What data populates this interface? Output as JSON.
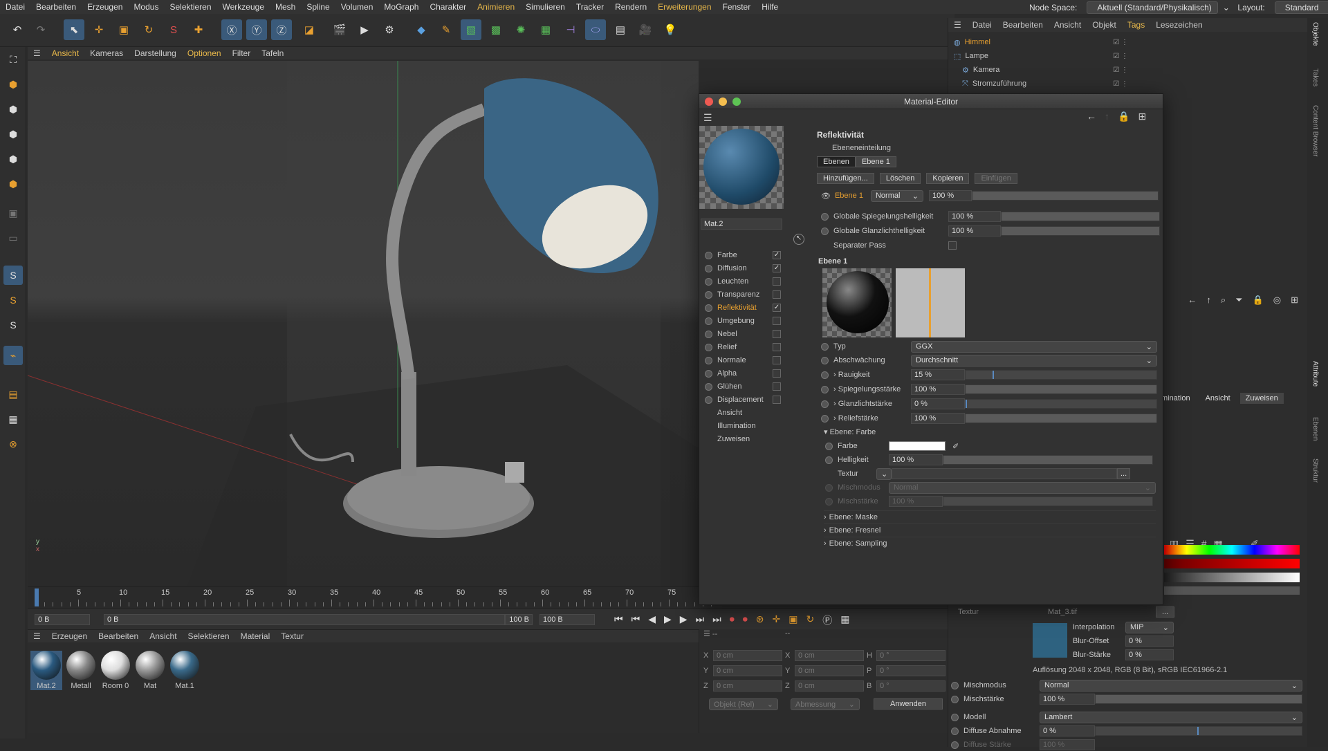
{
  "menu": {
    "items": [
      "Datei",
      "Bearbeiten",
      "Erzeugen",
      "Modus",
      "Selektieren",
      "Werkzeuge",
      "Mesh",
      "Spline",
      "Volumen",
      "MoGraph",
      "Charakter",
      "Animieren",
      "Simulieren",
      "Tracker",
      "Rendern",
      "Erweiterungen",
      "Fenster",
      "Hilfe"
    ],
    "node_space_label": "Node Space:",
    "node_space_value": "Aktuell (Standard/Physikalisch)",
    "layout_label": "Layout:",
    "layout_value": "Standard"
  },
  "viewport_menu": [
    "Ansicht",
    "Kameras",
    "Darstellung",
    "Optionen",
    "Filter",
    "Tafeln"
  ],
  "object_manager": {
    "menu": [
      "Datei",
      "Bearbeiten",
      "Ansicht",
      "Objekt",
      "Tags",
      "Lesezeichen"
    ],
    "objects": [
      {
        "name": "Himmel",
        "selected": true
      },
      {
        "name": "Lampe"
      },
      {
        "name": "Kamera"
      },
      {
        "name": "Stromzuführung"
      }
    ]
  },
  "vertical_tabs": [
    "Objekte",
    "Takes",
    "Content Browser",
    "Attribute",
    "Ebenen",
    "Struktur"
  ],
  "timeline": {
    "ticks": [
      "0",
      "5",
      "10",
      "15",
      "20",
      "25",
      "30",
      "35",
      "40",
      "45",
      "50",
      "55",
      "60",
      "65",
      "70",
      "75"
    ],
    "start": "0 B",
    "current": "0 B",
    "end": "100 B",
    "end2": "100 B"
  },
  "material_manager": {
    "menu": [
      "Erzeugen",
      "Bearbeiten",
      "Ansicht",
      "Selektieren",
      "Material",
      "Textur"
    ],
    "materials": [
      {
        "name": "Mat.2",
        "color": "#2a5a80"
      },
      {
        "name": "Metall",
        "color": "#888888"
      },
      {
        "name": "Room 0",
        "color": "#dddddd"
      },
      {
        "name": "Mat",
        "color": "#999999"
      },
      {
        "name": "Mat.1",
        "color": "#3a6a8a"
      }
    ]
  },
  "coords": {
    "x": "0 cm",
    "y": "0 cm",
    "z": "0 cm",
    "sx": "0 cm",
    "sy": "0 cm",
    "sz": "0 cm",
    "h": "0 °",
    "p": "0 °",
    "b": "0 °",
    "mode": "Objekt (Rel)",
    "size": "Abmessung",
    "apply": "Anwenden"
  },
  "editor": {
    "title": "Material-Editor",
    "mat_name": "Mat.2",
    "channels": [
      {
        "name": "Farbe",
        "checked": true
      },
      {
        "name": "Diffusion",
        "checked": true
      },
      {
        "name": "Leuchten",
        "checked": false
      },
      {
        "name": "Transparenz",
        "checked": false
      },
      {
        "name": "Reflektivität",
        "checked": true,
        "active": true
      },
      {
        "name": "Umgebung",
        "checked": false
      },
      {
        "name": "Nebel",
        "checked": false
      },
      {
        "name": "Relief",
        "checked": false
      },
      {
        "name": "Normale",
        "checked": false
      },
      {
        "name": "Alpha",
        "checked": false
      },
      {
        "name": "Glühen",
        "checked": false
      },
      {
        "name": "Displacement",
        "checked": false
      }
    ],
    "extra": [
      "Ansicht",
      "Illumination",
      "Zuweisen"
    ],
    "section_title": "Reflektivität",
    "ebeneneinteilung": "Ebeneneinteilung",
    "tabs": [
      "Ebenen",
      "Ebene 1"
    ],
    "buttons": [
      "Hinzufügen...",
      "Löschen",
      "Kopieren",
      "Einfügen"
    ],
    "layer": {
      "name": "Ebene 1",
      "mode": "Normal",
      "value": "100 %"
    },
    "glob_spec_label": "Globale Spiegelungshelligkeit",
    "glob_spec": "100 %",
    "glob_gloss_label": "Globale Glanzlichthelligkeit",
    "glob_gloss": "100 %",
    "sep_pass": "Separater Pass",
    "ebene1": "Ebene 1",
    "typ_label": "Typ",
    "typ": "GGX",
    "abs_label": "Abschwächung",
    "abs": "Durchschnitt",
    "rough_label": "Rauigkeit",
    "rough": "15 %",
    "spec_label": "Spiegelungsstärke",
    "spec": "100 %",
    "gloss_label": "Glanzlichtstärke",
    "gloss": "0 %",
    "relief_label": "Reliefstärke",
    "relief": "100 %",
    "ebene_farbe": "Ebene: Farbe",
    "farbe_label": "Farbe",
    "hell_label": "Helligkeit",
    "hell": "100 %",
    "textur_label": "Textur",
    "misch_label": "Mischmodus",
    "misch": "Normal",
    "mischst_label": "Mischstärke",
    "mischst": "100 %",
    "sections": [
      "Ebene: Maske",
      "Ebene: Fresnel",
      "Ebene: Sampling"
    ],
    "levels": {
      "rough": 0.15,
      "spec": 1.0,
      "gloss": 0.0,
      "relief": 1.0
    }
  },
  "attributes": {
    "tabs": [
      "mination",
      "Ansicht",
      "Zuweisen"
    ],
    "textur_label": "Textur",
    "textur_file": "Mat_3.tif",
    "interp_label": "Interpolation",
    "interp": "MIP",
    "bluroff_label": "Blur-Offset",
    "bluroff": "0 %",
    "blurst_label": "Blur-Stärke",
    "blurst": "0 %",
    "res": "Auflösung 2048 x 2048, RGB (8 Bit), sRGB IEC61966-2.1",
    "mischmodus_label": "Mischmodus",
    "mischmodus": "Normal",
    "mischst_label": "Mischstärke",
    "mischst": "100 %",
    "modell_label": "Modell",
    "modell": "Lambert",
    "diffab_label": "Diffuse Abnahme",
    "diffab": "0 %",
    "diffst_label": "Diffuse Stärke",
    "diffst": "100 %"
  }
}
